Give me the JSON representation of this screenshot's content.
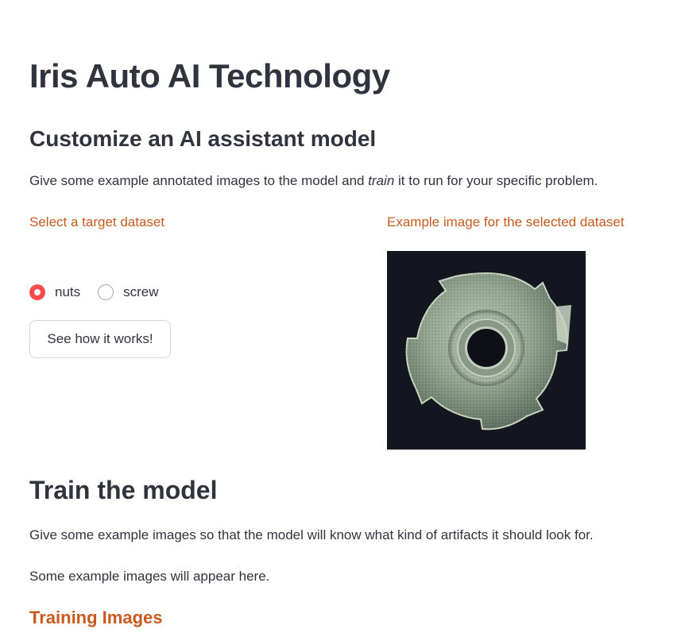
{
  "header": {
    "title": "Iris Auto AI Technology"
  },
  "customize": {
    "heading": "Customize an AI assistant model",
    "description_pre": "Give some example annotated images to the model and ",
    "description_em": "train",
    "description_post": " it to run for your specific problem.",
    "dataset_label": "Select a target dataset",
    "example_label": "Example image for the selected dataset",
    "radio_options": [
      {
        "label": "nuts",
        "selected": true
      },
      {
        "label": "screw",
        "selected": false
      }
    ],
    "how_button": "See how it works!",
    "example_image_icon": "metal-nut-image"
  },
  "train": {
    "heading": "Train the model",
    "description": "Give some example images so that the model will know what kind of artifacts it should look for.",
    "placeholder_text": "Some example images will appear here.",
    "training_images_heading": "Training Images"
  },
  "colors": {
    "accent_orange": "#c85a1e",
    "radio_selected": "#ff4b4b",
    "text": "#31333f"
  }
}
